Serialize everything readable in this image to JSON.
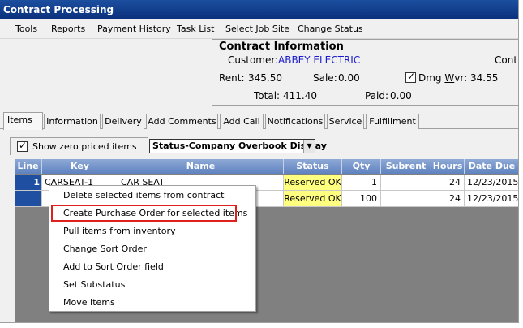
{
  "window": {
    "title": "Contract Processing"
  },
  "menu": [
    "Tools",
    "Reports",
    "Payment History",
    "Task List",
    "Select Job Site",
    "Change Status"
  ],
  "contract_info": {
    "heading": "Contract Information",
    "customer_label": "Customer:",
    "customer_value": "ABBEY ELECTRIC",
    "contr_label": "Contr",
    "rent_label": "Rent:",
    "rent_value": "345.50",
    "sale_label": "Sale:",
    "sale_value": "0.00",
    "dmg_wvr_prefix": "Dmg ",
    "dmg_wvr_underlined": "W",
    "dmg_wvr_rest": "vr:",
    "dmg_wvr_value": "34.55",
    "dmg_wvr_checked": true,
    "total_label": "Total:",
    "total_value": "411.40",
    "paid_label": "Paid:",
    "paid_value": "0.00"
  },
  "tabs": [
    "Items",
    "Information",
    "Delivery",
    "Add Comments",
    "Add Call",
    "Notifications",
    "Service",
    "Fulfillment"
  ],
  "active_tab": "Items",
  "toolbar": {
    "show_zero_label": "Show zero priced items",
    "show_zero_checked": true,
    "display_select_value": "Status-Company Overbook Display"
  },
  "grid": {
    "columns": [
      "Line",
      "Key",
      "Name",
      "Status",
      "Qty",
      "Subrent",
      "Hours",
      "Date Due"
    ],
    "rows": [
      {
        "line": "1",
        "key": "CARSEAT-1",
        "name": "CAR SEAT",
        "status": "Reserved OK",
        "qty": "1",
        "subrent": "",
        "hours": "24",
        "date_due": "12/23/2015"
      },
      {
        "line": "",
        "key": "",
        "name": "",
        "status": "Reserved OK",
        "qty": "100",
        "subrent": "",
        "hours": "24",
        "date_due": "12/23/2015"
      }
    ]
  },
  "context_menu": [
    "Delete selected items from contract",
    "Create Purchase Order for selected items",
    "Pull items from inventory",
    "Change Sort Order",
    "Add to Sort Order field",
    "Set Substatus",
    "Move Items"
  ],
  "highlighted_item": "Create Purchase Order for selected items",
  "colors": {
    "title_bar": "#0a2f7c",
    "grid_header": "#5f82c0",
    "selection": "#1f4fa0",
    "status_highlight": "#ffff80",
    "annotation_box": "#e0201c",
    "customer_link": "#1a1acc"
  }
}
